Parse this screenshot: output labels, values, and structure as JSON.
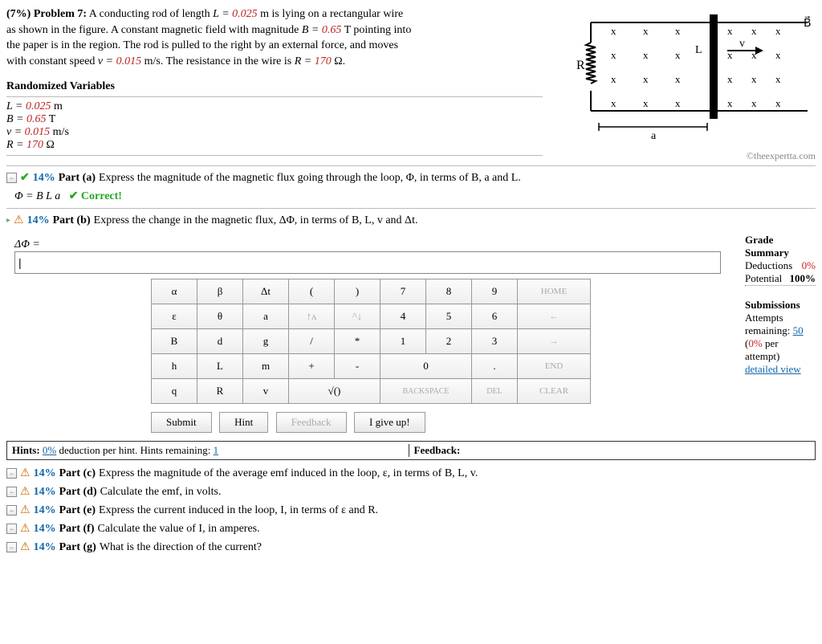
{
  "problem": {
    "number_label": "(7%)",
    "title": "Problem 7:",
    "text_line1_a": "A conducting rod of length ",
    "L_eq": "L = ",
    "L_val": "0.025",
    "L_unit": " m is lying on a rectangular wire",
    "text_line2": "as shown in the figure. A constant magnetic field with magnitude ",
    "B_eq": "B = ",
    "B_val": "0.65",
    "B_unit": " T pointing into",
    "text_line3": "the paper is in the region. The rod is pulled to the right by an external force, and moves",
    "text_line4a": "with constant speed ",
    "v_eq": "v = ",
    "v_val": "0.015",
    "v_unit": " m/s. The resistance in the wire is ",
    "R_eq": "R = ",
    "R_val": "170",
    "R_unit": " Ω."
  },
  "randvars": {
    "title": "Randomized Variables",
    "L": "L = 0.025 m",
    "B": "B = 0.65 T",
    "v": "v = 0.015 m/s",
    "R": "R = 170 Ω",
    "L_val": "0.025",
    "B_val": "0.65",
    "v_val": "0.015",
    "R_val": "170"
  },
  "figure": {
    "R": "R",
    "L": "L",
    "v": "v",
    "a": "a",
    "B": "B",
    "x": "x",
    "copyright": "©theexpertta.com"
  },
  "parts": {
    "a": {
      "pct": "14%",
      "label": "Part (a)",
      "text": "Express the magnitude of the magnetic flux going through the loop, Φ, in terms of B, a and L.",
      "answer": "Φ = B L a",
      "status": "✔ Correct!"
    },
    "b": {
      "pct": "14%",
      "label": "Part (b)",
      "text": "Express the change in the magnetic flux, ΔΦ, in terms of B, L, v and Δt.",
      "prompt": "ΔΦ ="
    },
    "c": {
      "pct": "14%",
      "label": "Part (c)",
      "text": "Express the magnitude of the average emf induced in the loop, ε, in terms of B, L, v."
    },
    "d": {
      "pct": "14%",
      "label": "Part (d)",
      "text": "Calculate the emf, in volts."
    },
    "e": {
      "pct": "14%",
      "label": "Part (e)",
      "text": "Express the current induced in the loop, I, in terms of ε and R."
    },
    "f": {
      "pct": "14%",
      "label": "Part (f)",
      "text": "Calculate the value of I, in amperes."
    },
    "g": {
      "pct": "14%",
      "label": "Part (g)",
      "text": "What is the direction of the current?"
    }
  },
  "keypad": {
    "r1": [
      "α",
      "β",
      "Δt",
      "(",
      ")",
      "7",
      "8",
      "9",
      "HOME"
    ],
    "r2": [
      "ε",
      "θ",
      "a",
      "↑ᴧ",
      "^↓",
      "4",
      "5",
      "6",
      "←"
    ],
    "r3": [
      "B",
      "d",
      "g",
      "/",
      "*",
      "1",
      "2",
      "3",
      "→"
    ],
    "r4": [
      "h",
      "L",
      "m",
      "+",
      "-",
      "0",
      ".",
      "END"
    ],
    "r5": [
      "q",
      "R",
      "v",
      "√()",
      "BACKSPACE",
      "DEL",
      "CLEAR"
    ]
  },
  "buttons": {
    "submit": "Submit",
    "hint": "Hint",
    "feedback": "Feedback",
    "giveup": "I give up!"
  },
  "grade": {
    "title": "Grade Summary",
    "ded_label": "Deductions",
    "ded_val": "0%",
    "pot_label": "Potential",
    "pot_val": "100%",
    "sub_title": "Submissions",
    "attempts": "Attempts remaining: ",
    "attempts_val": "50",
    "per": "(0% per attempt)",
    "detailed": "detailed view"
  },
  "hints": {
    "left_a": "Hints: ",
    "left_pct": "0%",
    "left_b": " deduction per hint. Hints remaining: ",
    "left_n": "1",
    "right": "Feedback:"
  }
}
